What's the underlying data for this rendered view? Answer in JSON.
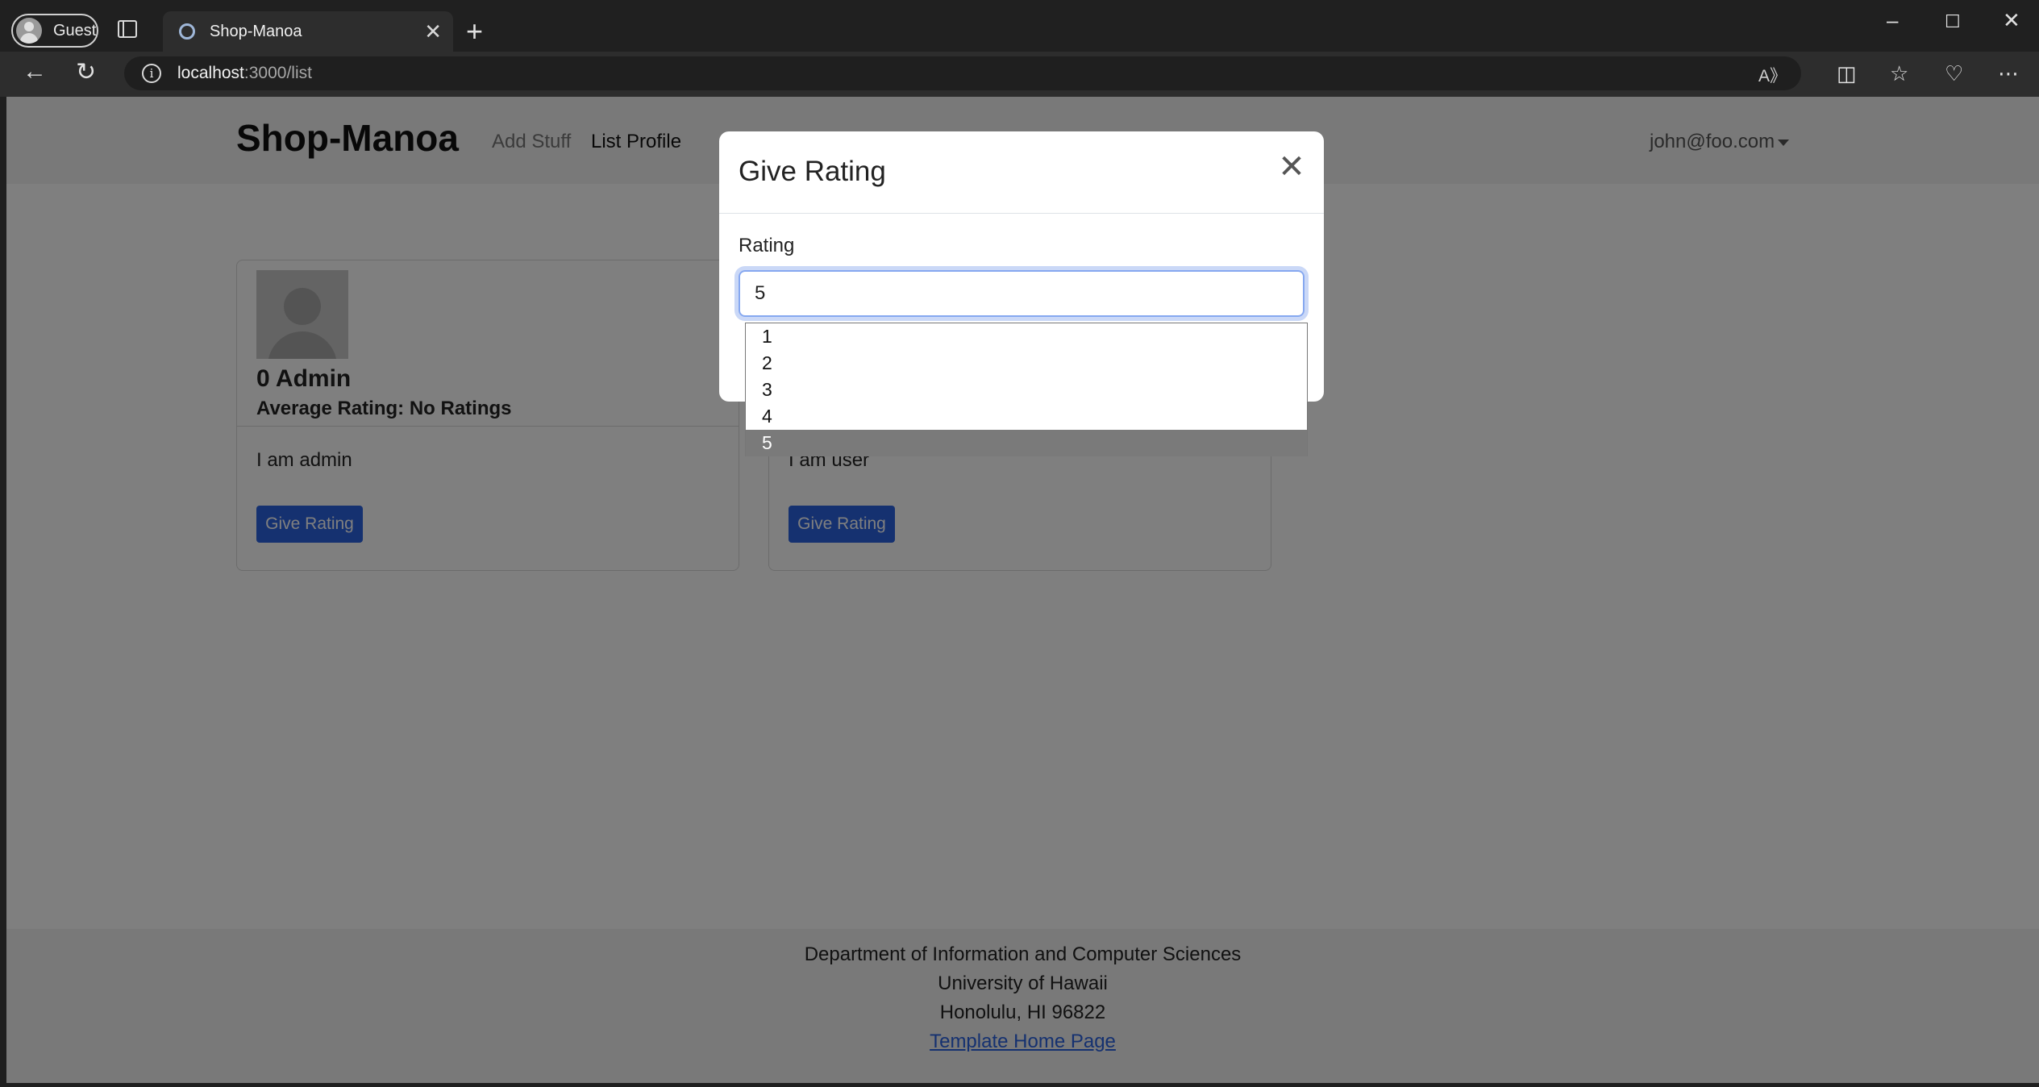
{
  "browser": {
    "profile_label": "Guest",
    "tab_title": "Shop-Manoa",
    "url_host": "localhost",
    "url_path": ":3000/list"
  },
  "navbar": {
    "brand": "Shop-Manoa",
    "links": [
      "Add Stuff",
      "List Profile"
    ],
    "user": "john@foo.com"
  },
  "cards": [
    {
      "name": "0 Admin",
      "rating": "Average Rating: No Ratings",
      "description": "I am admin",
      "button": "Give Rating"
    },
    {
      "name": "",
      "rating": "",
      "description": "I am user",
      "button": "Give Rating"
    }
  ],
  "modal": {
    "title": "Give Rating",
    "field_label": "Rating",
    "selected_value": "5",
    "options": [
      "1",
      "2",
      "3",
      "4",
      "5"
    ]
  },
  "footer": {
    "line1": "Department of Information and Computer Sciences",
    "line2": "University of Hawaii",
    "line3": "Honolulu, HI 96822",
    "link": "Template Home Page"
  },
  "colors": {
    "primary": "#2b62e0",
    "navbar_bg": "#f2f2f2",
    "option_selected": "#7a7a7a"
  }
}
